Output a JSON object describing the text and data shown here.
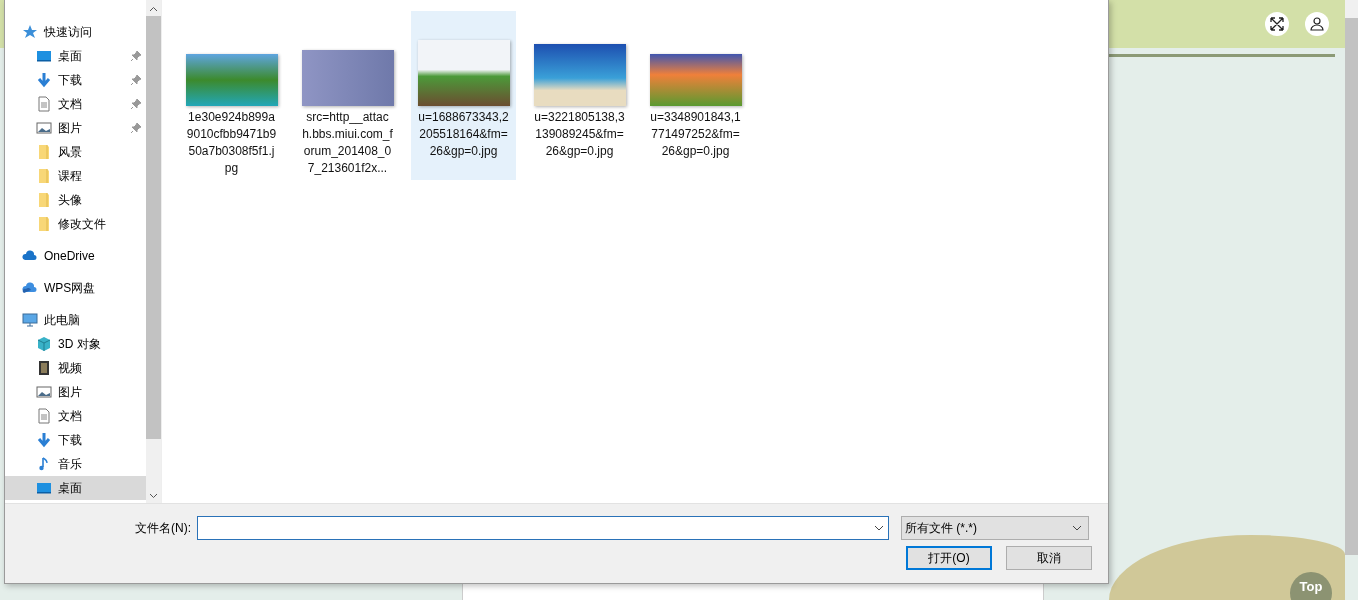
{
  "background_page": {
    "top_button": "Top"
  },
  "nav": [
    {
      "label": "快速访问",
      "kind": "star",
      "selected": false,
      "children": [
        {
          "label": "桌面",
          "kind": "desktop",
          "pinned": true,
          "selected": false
        },
        {
          "label": "下载",
          "kind": "download",
          "pinned": true,
          "selected": false
        },
        {
          "label": "文档",
          "kind": "document",
          "pinned": true,
          "selected": false
        },
        {
          "label": "图片",
          "kind": "picture",
          "pinned": true,
          "selected": false
        },
        {
          "label": "风景",
          "kind": "folder",
          "pinned": false,
          "selected": false
        },
        {
          "label": "课程",
          "kind": "folder",
          "pinned": false,
          "selected": false
        },
        {
          "label": "头像",
          "kind": "folder",
          "pinned": false,
          "selected": false
        },
        {
          "label": "修改文件",
          "kind": "folder",
          "pinned": false,
          "selected": false
        }
      ]
    },
    {
      "label": "OneDrive",
      "kind": "cloud",
      "selected": false
    },
    {
      "label": "WPS网盘",
      "kind": "clouds",
      "selected": false
    },
    {
      "label": "此电脑",
      "kind": "pc",
      "selected": false,
      "children": [
        {
          "label": "3D 对象",
          "kind": "cube",
          "selected": false
        },
        {
          "label": "视频",
          "kind": "video",
          "selected": false
        },
        {
          "label": "图片",
          "kind": "picture",
          "selected": false
        },
        {
          "label": "文档",
          "kind": "document",
          "selected": false
        },
        {
          "label": "下载",
          "kind": "download",
          "selected": false
        },
        {
          "label": "音乐",
          "kind": "music",
          "selected": false
        },
        {
          "label": "桌面",
          "kind": "desktop",
          "selected": true
        }
      ]
    }
  ],
  "files": [
    {
      "name": "1e30e924b899a9010cfbb9471b950a7b0308f5f1.jpg",
      "selected": false
    },
    {
      "name": "src=http__attach.bbs.miui.com_forum_201408_07_213601f2x...",
      "selected": false
    },
    {
      "name": "u=1688673343,2205518164&fm=26&gp=0.jpg",
      "selected": true
    },
    {
      "name": "u=3221805138,3139089245&fm=26&gp=0.jpg",
      "selected": false
    },
    {
      "name": "u=3348901843,1771497252&fm=26&gp=0.jpg",
      "selected": false
    }
  ],
  "filename": {
    "label": "文件名(N):"
  },
  "filter": {
    "value": "所有文件 (*.*)"
  },
  "buttons": [
    {
      "label": "打开(O)",
      "default": true
    },
    {
      "label": "取消",
      "default": false
    }
  ]
}
